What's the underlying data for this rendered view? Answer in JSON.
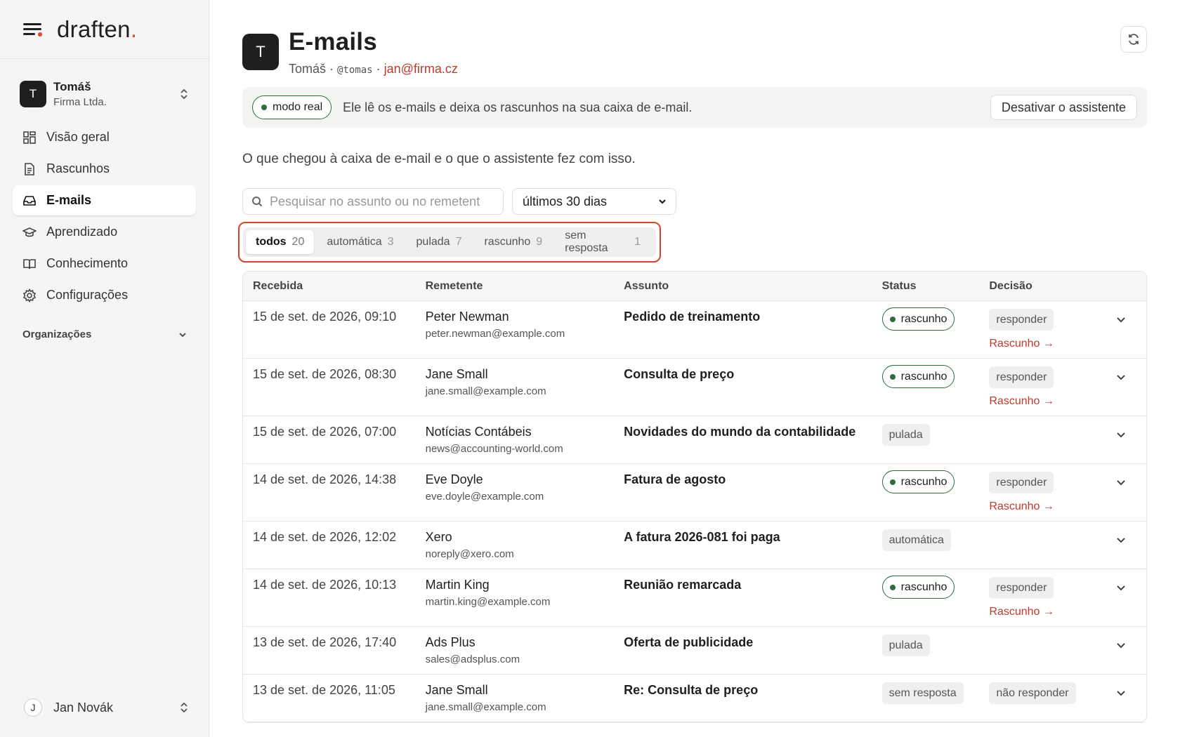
{
  "brand": {
    "name": "draften",
    "dot": "."
  },
  "account": {
    "initial": "T",
    "name": "Tomáš",
    "org": "Firma Ltda."
  },
  "nav": [
    {
      "label": "Visão geral",
      "icon": "grid-icon"
    },
    {
      "label": "Rascunhos",
      "icon": "document-icon"
    },
    {
      "label": "E-mails",
      "icon": "inbox-icon",
      "active": true
    },
    {
      "label": "Aprendizado",
      "icon": "graduation-cap-icon"
    },
    {
      "label": "Conhecimento",
      "icon": "book-icon"
    },
    {
      "label": "Configurações",
      "icon": "gear-icon"
    }
  ],
  "orgs_label": "Organizações",
  "user": {
    "initial": "J",
    "name": "Jan Novák"
  },
  "header": {
    "initial": "T",
    "title": "E-mails",
    "name": "Tomáš",
    "sep": " · ",
    "handle": "@tomas",
    "email": "jan@firma.cz"
  },
  "banner": {
    "mode": "modo real",
    "text": "Ele lê os e-mails e deixa os rascunhos na sua caixa de e-mail.",
    "button": "Desativar o assistente"
  },
  "intro": "O que chegou à caixa de e-mail e o que o assistente fez com isso.",
  "search": {
    "placeholder": "Pesquisar no assunto ou no remetent"
  },
  "range": {
    "selected": "últimos 30 dias"
  },
  "tabs": [
    {
      "label": "todos",
      "count": "20",
      "active": true
    },
    {
      "label": "automática",
      "count": "3"
    },
    {
      "label": "pulada",
      "count": "7"
    },
    {
      "label": "rascunho",
      "count": "9"
    },
    {
      "label": "sem resposta",
      "count": "1"
    }
  ],
  "table": {
    "headers": [
      "Recebida",
      "Remetente",
      "Assunto",
      "Status",
      "Decisão"
    ],
    "rows": [
      {
        "date": "15 de set. de 2026, 09:10",
        "name": "Peter Newman",
        "email": "peter.newman@example.com",
        "subject": "Pedido de treinamento",
        "status": "rascunho",
        "decision": "responder",
        "link": "Rascunho →"
      },
      {
        "date": "15 de set. de 2026, 08:30",
        "name": "Jane Small",
        "email": "jane.small@example.com",
        "subject": "Consulta de preço",
        "status": "rascunho",
        "decision": "responder",
        "link": "Rascunho →"
      },
      {
        "date": "15 de set. de 2026, 07:00",
        "name": "Notícias Contábeis",
        "email": "news@accounting-world.com",
        "subject": "Novidades do mundo da contabilidade",
        "status": "pulada",
        "decision": "",
        "link": ""
      },
      {
        "date": "14 de set. de 2026, 14:38",
        "name": "Eve Doyle",
        "email": "eve.doyle@example.com",
        "subject": "Fatura de agosto",
        "status": "rascunho",
        "decision": "responder",
        "link": "Rascunho →"
      },
      {
        "date": "14 de set. de 2026, 12:02",
        "name": "Xero",
        "email": "noreply@xero.com",
        "subject": "A fatura 2026-081 foi paga",
        "status": "automática",
        "decision": "",
        "link": ""
      },
      {
        "date": "14 de set. de 2026, 10:13",
        "name": "Martin King",
        "email": "martin.king@example.com",
        "subject": "Reunião remarcada",
        "status": "rascunho",
        "decision": "responder",
        "link": "Rascunho →"
      },
      {
        "date": "13 de set. de 2026, 17:40",
        "name": "Ads Plus",
        "email": "sales@adsplus.com",
        "subject": "Oferta de publicidade",
        "status": "pulada",
        "decision": "",
        "link": ""
      },
      {
        "date": "13 de set. de 2026, 11:05",
        "name": "Jane Small",
        "email": "jane.small@example.com",
        "subject": "Re: Consulta de preço",
        "status": "sem resposta",
        "decision": "não responder",
        "link": ""
      }
    ]
  },
  "colors": {
    "accent": "#d64a2a",
    "link": "#c0392b",
    "green": "#2f6b3f"
  }
}
